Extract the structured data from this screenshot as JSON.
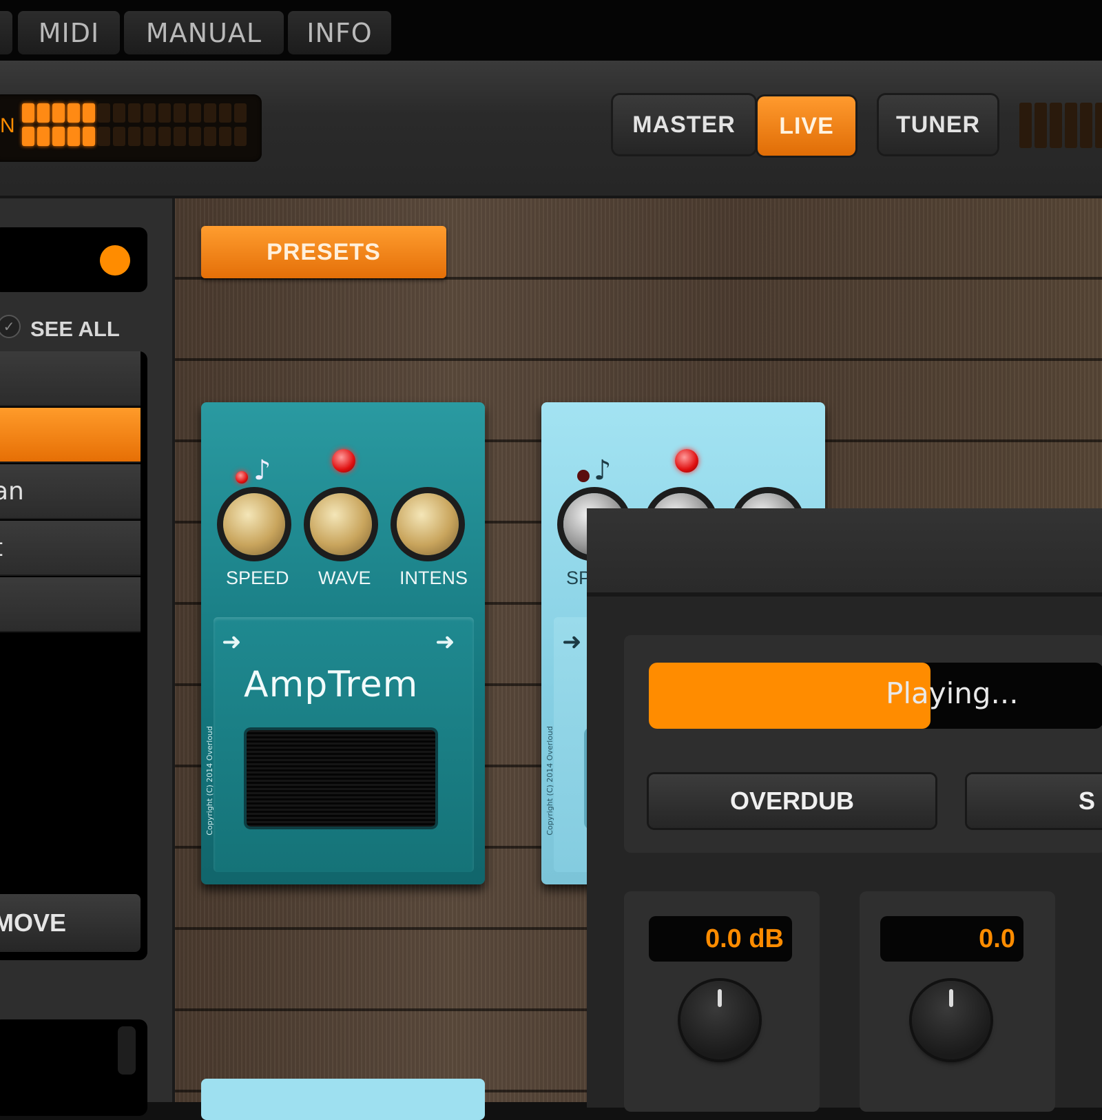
{
  "menu": {
    "items": [
      "MIDI",
      "MANUAL",
      "INFO"
    ]
  },
  "header": {
    "input_meter_label_fragment": "N",
    "master_label": "MASTER",
    "live_label": "LIVE",
    "tuner_label": "TUNER"
  },
  "sidebar": {
    "see_all_label": "SEE ALL",
    "items": [
      "",
      "",
      "an",
      "t",
      ""
    ],
    "selected_index": 1,
    "remove_label": "MOVE"
  },
  "board": {
    "presets_label": "PRESETS",
    "pedals": [
      {
        "name": "AmpTrem",
        "knobs": [
          "SPEED",
          "WAVE",
          "INTENS"
        ],
        "copyright": "Copyright (C) 2014 Overloud"
      },
      {
        "name": "",
        "knobs": [
          "SPE"
        ],
        "copyright": "Copyright (C) 2014 Overloud"
      }
    ]
  },
  "looper": {
    "status_text": "Playing...",
    "progress": 0.62,
    "overdub_label": "OVERDUB",
    "second_button_fragment": "S",
    "readouts": [
      "0.0 dB",
      "0.0"
    ]
  },
  "colors": {
    "accent": "#ff8c00",
    "pedal1": "#1a7f86",
    "pedal2": "#8fd7ea"
  }
}
